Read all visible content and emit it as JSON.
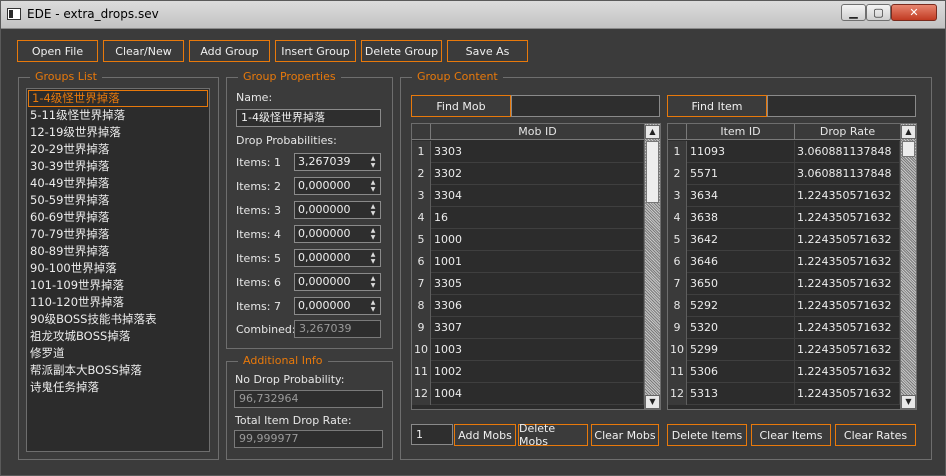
{
  "window": {
    "title": "EDE - extra_drops.sev",
    "min": "▁",
    "max": "▢",
    "close": "✕"
  },
  "toolbar": {
    "open_file": "Open File",
    "clear_new": "Clear/New",
    "add_group": "Add Group",
    "insert_group": "Insert Group",
    "delete_group": "Delete Group",
    "save_as": "Save As"
  },
  "groups": {
    "title": "Groups List",
    "items": [
      "1-4级怪世界掉落",
      "5-11级怪世界掉落",
      "12-19级世界掉落",
      "20-29世界掉落",
      "30-39世界掉落",
      "40-49世界掉落",
      "50-59世界掉落",
      "60-69世界掉落",
      "70-79世界掉落",
      "80-89世界掉落",
      "90-100世界掉落",
      "101-109世界掉落",
      "110-120世界掉落",
      "90级BOSS技能书掉落表",
      "祖龙攻城BOSS掉落",
      "修罗道",
      "帮派副本大BOSS掉落",
      "诗鬼任务掉落"
    ]
  },
  "props": {
    "title": "Group Properties",
    "name_label": "Name:",
    "name_value": "1-4级怪世界掉落",
    "drop_label": "Drop Probabilities:",
    "items": [
      {
        "label": "Items: 1",
        "value": "3,267039"
      },
      {
        "label": "Items: 2",
        "value": "0,000000"
      },
      {
        "label": "Items: 3",
        "value": "0,000000"
      },
      {
        "label": "Items: 4",
        "value": "0,000000"
      },
      {
        "label": "Items: 5",
        "value": "0,000000"
      },
      {
        "label": "Items: 6",
        "value": "0,000000"
      },
      {
        "label": "Items: 7",
        "value": "0,000000"
      }
    ],
    "combined_label": "Combined:",
    "combined_value": "3,267039"
  },
  "info": {
    "title": "Additional Info",
    "no_drop_label": "No Drop Probability:",
    "no_drop_value": "96,732964",
    "total_label": "Total Item Drop Rate:",
    "total_value": "99,999977"
  },
  "content": {
    "title": "Group Content",
    "find_mob": "Find Mob",
    "find_item": "Find Item",
    "mob_header": "Mob ID",
    "item_header": "Item ID",
    "rate_header": "Drop Rate",
    "mobs": [
      {
        "n": "1",
        "id": "3303"
      },
      {
        "n": "2",
        "id": "3302"
      },
      {
        "n": "3",
        "id": "3304"
      },
      {
        "n": "4",
        "id": "16"
      },
      {
        "n": "5",
        "id": "1000"
      },
      {
        "n": "6",
        "id": "1001"
      },
      {
        "n": "7",
        "id": "3305"
      },
      {
        "n": "8",
        "id": "3306"
      },
      {
        "n": "9",
        "id": "3307"
      },
      {
        "n": "10",
        "id": "1003"
      },
      {
        "n": "11",
        "id": "1002"
      },
      {
        "n": "12",
        "id": "1004"
      }
    ],
    "items": [
      {
        "n": "1",
        "id": "11093",
        "rate": "3.060881137848"
      },
      {
        "n": "2",
        "id": "5571",
        "rate": "3.060881137848"
      },
      {
        "n": "3",
        "id": "3634",
        "rate": "1.224350571632"
      },
      {
        "n": "4",
        "id": "3638",
        "rate": "1.224350571632"
      },
      {
        "n": "5",
        "id": "3642",
        "rate": "1.224350571632"
      },
      {
        "n": "6",
        "id": "3646",
        "rate": "1.224350571632"
      },
      {
        "n": "7",
        "id": "3650",
        "rate": "1.224350571632"
      },
      {
        "n": "8",
        "id": "5292",
        "rate": "1.224350571632"
      },
      {
        "n": "9",
        "id": "5320",
        "rate": "1.224350571632"
      },
      {
        "n": "10",
        "id": "5299",
        "rate": "1.224350571632"
      },
      {
        "n": "11",
        "id": "5306",
        "rate": "1.224350571632"
      },
      {
        "n": "12",
        "id": "5313",
        "rate": "1.224350571632"
      }
    ],
    "count_value": "1",
    "add_mobs": "Add Mobs",
    "delete_mobs": "Delete Mobs",
    "clear_mobs": "Clear Mobs",
    "delete_items": "Delete Items",
    "clear_items": "Clear Items",
    "clear_rates": "Clear Rates"
  },
  "icons": {
    "spin": "spin-arrows-icon",
    "scroll_up": "scroll-up-icon",
    "scroll_down": "scroll-down-icon"
  },
  "colors": {
    "accent": "#e8790b",
    "background": "#3b3b3b",
    "field": "#2c2c2c"
  }
}
